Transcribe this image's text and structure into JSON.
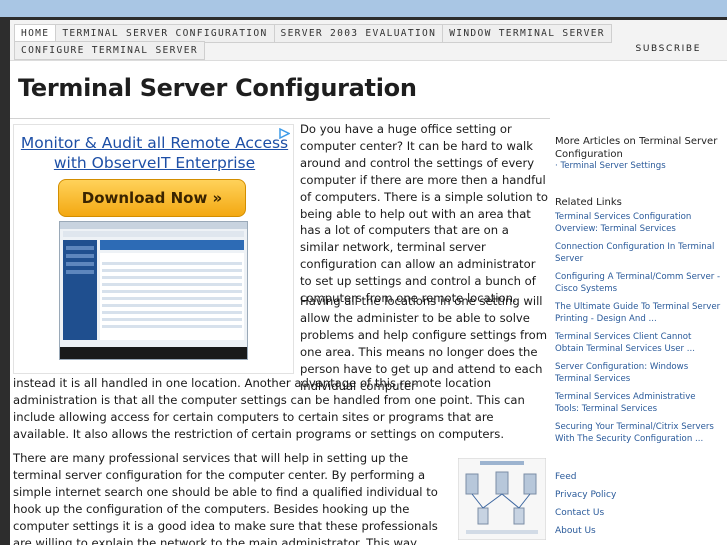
{
  "nav": {
    "row1": [
      "HOME",
      "TERMINAL SERVER CONFIGURATION",
      "SERVER 2003 EVALUATION",
      "WINDOW TERMINAL SERVER"
    ],
    "row2": [
      "CONFIGURE TERMINAL SERVER"
    ],
    "subscribe": "SUBSCRIBE"
  },
  "page_title": "Terminal Server Configuration",
  "ad": {
    "headline_line1": "Monitor & Audit all Remote Access",
    "headline_line2": "with ObserveIT Enterprise",
    "button": "Download Now »",
    "choices_icon": "adchoices-icon",
    "screenshot_icon": "product-screenshot"
  },
  "article": {
    "p1": "Do you have a huge office setting or computer center? It can be hard to walk around and control the settings of every computer if there are more then a handful of computers. There is a simple solution to being able to help out with an area that has a lot of computers that are on a similar network, terminal server configuration can allow an administrator to set up settings and control a bunch of computers from one remote location.",
    "p2": "Having all the locations in one setting will allow the administer to be able to solve problems and help configure settings from one area. This means no longer does the person have to get up and attend to each individual computer",
    "p3": "instead it is all handled in one location. Another advantage of this remote location administration is that all the computer settings can be handled from one point. This can include allowing access for certain computers to certain sites or programs that are available. It also allows the restriction of certain programs or settings on computers.",
    "p4": "There are many professional services that will help in setting up the terminal server configuration for the computer center. By performing a simple internet search one should be able to find a qualified individual to hook up the configuration of the computers. Besides hooking up the computer settings it is a good idea to make sure that these professionals are willing to explain the network to the main administrator. This way there is no confusion when the professional leaves and the computer",
    "diagram_icon": "network-diagram"
  },
  "sidebar": {
    "more_heading": "More Articles on Terminal Server Configuration",
    "more_link": "· Terminal Server Settings",
    "related_heading": "Related Links",
    "related": [
      "Terminal Services Configuration Overview: Terminal Services",
      "Connection Configuration In Terminal Server",
      "Configuring A Terminal/Comm Server - Cisco Systems",
      "The Ultimate Guide To Terminal Server Printing - Design And ...",
      "Terminal Services Client Cannot Obtain Terminal Services User ...",
      "Server Configuration: Windows Terminal Services",
      "Terminal Services Administrative Tools: Terminal Services",
      "Securing Your Terminal/Citrix Servers With The Security Configuration ..."
    ],
    "footer_links": [
      "Feed",
      "Privacy Policy",
      "Contact Us",
      "About Us"
    ]
  },
  "colors": {
    "top_band": "#a9c6e4",
    "frame": "#2d2d2d",
    "link": "#2a5a9a",
    "ad_headline": "#1d4fa6",
    "ad_button": "#f3a812"
  }
}
